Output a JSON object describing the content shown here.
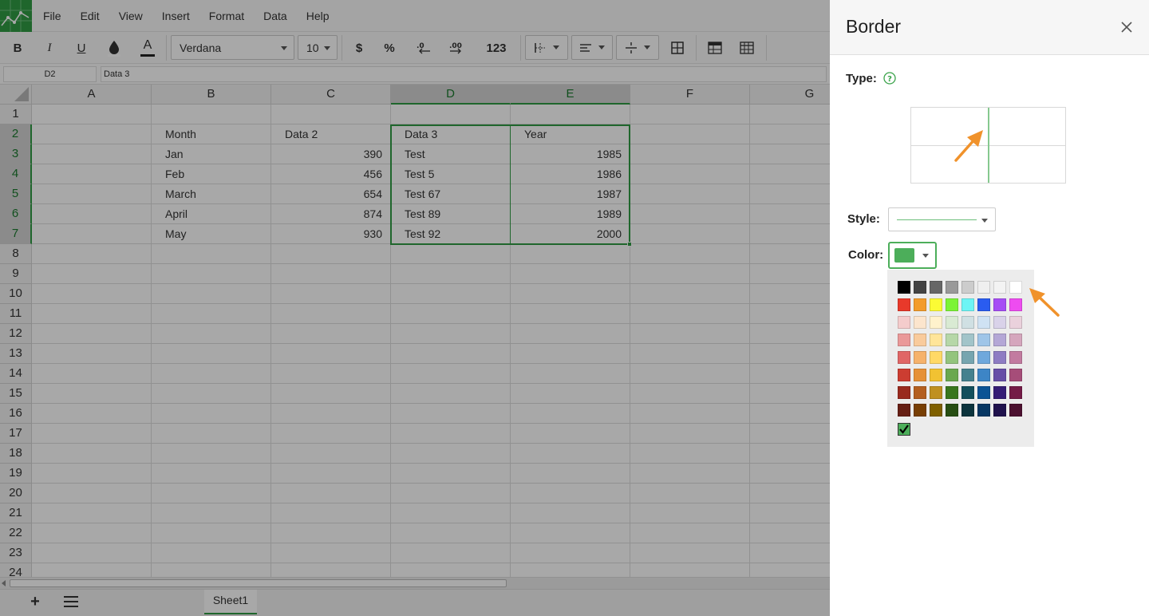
{
  "menu": {
    "items": [
      "File",
      "Edit",
      "View",
      "Insert",
      "Format",
      "Data",
      "Help"
    ]
  },
  "toolbar": {
    "bold_label": "B",
    "italic_label": "I",
    "underline_label": "U",
    "text_color_label": "A",
    "font_family": "Verdana",
    "font_size": "10",
    "currency_label": "$",
    "percent_label": "%",
    "number_format_label": "123"
  },
  "formula_bar": {
    "cell_ref": "D2",
    "value": "Data 3"
  },
  "grid": {
    "columns": [
      "A",
      "B",
      "C",
      "D",
      "E",
      "F",
      "G"
    ],
    "rows": [
      "1",
      "2",
      "3",
      "4",
      "5",
      "6",
      "7",
      "8",
      "9",
      "10",
      "11",
      "12",
      "13",
      "14",
      "15",
      "16",
      "17",
      "18",
      "19",
      "20",
      "21",
      "22",
      "23",
      "24"
    ],
    "selected_columns": [
      "D",
      "E"
    ],
    "selected_rows": [
      "2",
      "3",
      "4",
      "5",
      "6",
      "7"
    ],
    "cells": [
      [
        "",
        "",
        "",
        "",
        ""
      ],
      [
        "",
        "Month",
        "Data 2",
        "Data 3",
        "Year"
      ],
      [
        "",
        "Jan",
        "390",
        "Test",
        "1985"
      ],
      [
        "",
        "Feb",
        "456",
        "Test 5",
        "1986"
      ],
      [
        "",
        "March",
        "654",
        "Test 67",
        "1987"
      ],
      [
        "",
        "April",
        "874",
        "Test 89",
        "1989"
      ],
      [
        "",
        "May",
        "930",
        "Test 92",
        "2000"
      ]
    ]
  },
  "sheets": {
    "tabs": [
      "Sheet1"
    ],
    "active": "Sheet1"
  },
  "border_panel": {
    "title": "Border",
    "type_label": "Type:",
    "style_label": "Style:",
    "color_label": "Color:",
    "selected_color": "#4cae5a",
    "palette": [
      [
        "#000000",
        "#434343",
        "#666666",
        "#999999",
        "#cccccc",
        "#efefef",
        "#f3f3f3",
        "#ffffff"
      ],
      [
        "#e8392a",
        "#f39c2c",
        "#fbfb35",
        "#7cf437",
        "#6df5f5",
        "#2a5cf0",
        "#a64df5",
        "#ee4cf0"
      ],
      [
        "#f4cccc",
        "#fce5cd",
        "#fff2cc",
        "#d9ead3",
        "#d0e0e3",
        "#cfe2f3",
        "#d9d2e9",
        "#ead1dc"
      ],
      [
        "#ea9999",
        "#f9cb9c",
        "#ffe599",
        "#b6d7a8",
        "#a2c4c9",
        "#9fc5e8",
        "#b4a7d6",
        "#d5a6bd"
      ],
      [
        "#e06666",
        "#f6b26b",
        "#ffd966",
        "#93c47d",
        "#76a5af",
        "#6fa8dc",
        "#8e7cc3",
        "#c27ba0"
      ],
      [
        "#cc3d31",
        "#e69138",
        "#f1c232",
        "#6aa84f",
        "#45818e",
        "#3d85c6",
        "#674ea7",
        "#a64d79"
      ],
      [
        "#992a1e",
        "#b45f1f",
        "#bf9020",
        "#38761d",
        "#134f5c",
        "#0b5394",
        "#351c75",
        "#741b47"
      ],
      [
        "#661f14",
        "#783f04",
        "#7f6000",
        "#274e13",
        "#0c343d",
        "#073763",
        "#20124d",
        "#4c1130"
      ]
    ],
    "custom_colors": [
      "#4cae5a"
    ]
  }
}
